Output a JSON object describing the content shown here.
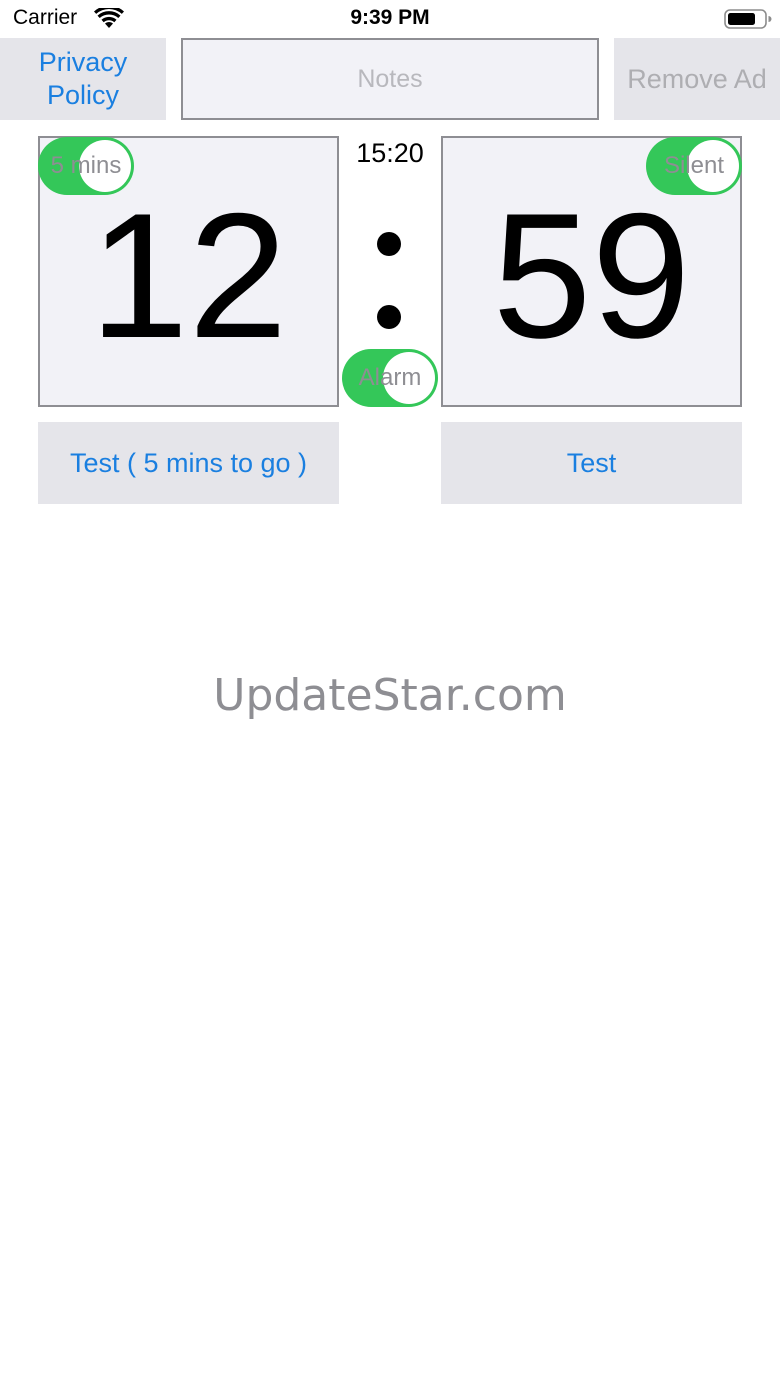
{
  "status_bar": {
    "carrier": "Carrier",
    "time": "9:39 PM",
    "wifi_icon": "wifi-icon",
    "battery_icon": "battery-icon"
  },
  "top_bar": {
    "privacy_label": "Privacy Policy",
    "notes_placeholder": "Notes",
    "remove_ad_label": "Remove Ad"
  },
  "timer": {
    "minutes": "12",
    "seconds": "59",
    "set_time": "15:20",
    "five_mins_label": "5 mins",
    "silent_label": "Silent",
    "alarm_label": "Alarm",
    "five_mins_on": true,
    "silent_on": true,
    "alarm_on": true
  },
  "buttons": {
    "test_left": "Test ( 5 mins to go )",
    "test_right": "Test"
  },
  "watermark": "UpdateStar.com",
  "colors": {
    "accent": "#1a7fe0",
    "toggle_on": "#34c759",
    "panel_bg": "#f2f2f7",
    "button_bg": "#e5e5ea"
  }
}
